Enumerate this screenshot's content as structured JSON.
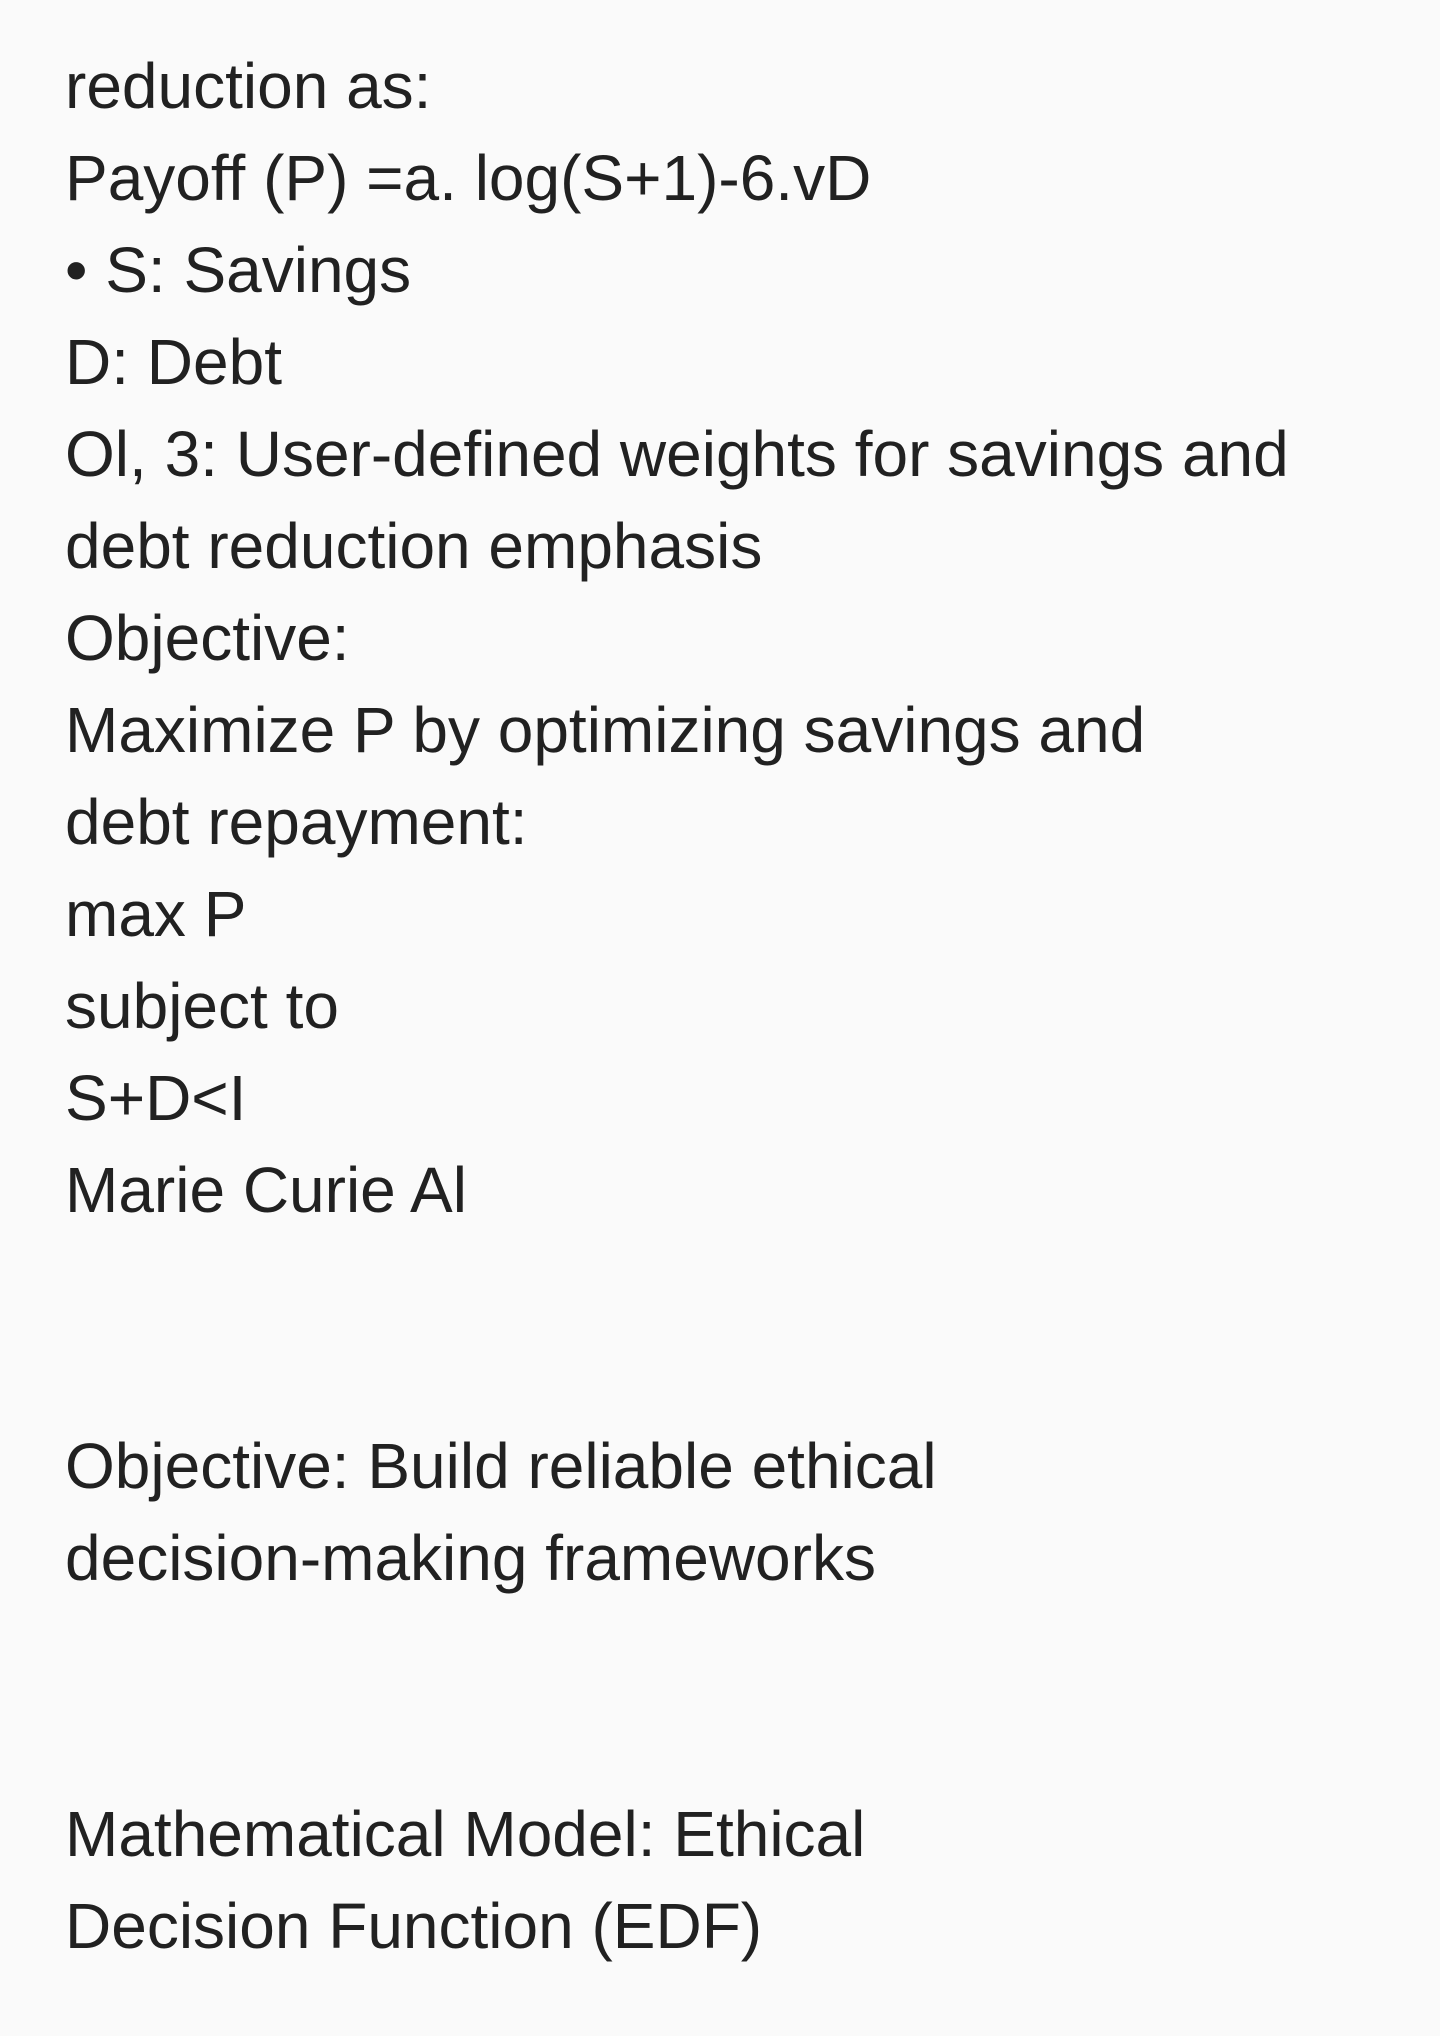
{
  "lines_block1": [
    "reduction as:",
    "Payoff (P) =a. log(S+1)-6.vD",
    "• S: Savings",
    "D: Debt",
    "Ol, 3: User-defined weights for savings and",
    "debt reduction emphasis",
    "Objective:",
    "Maximize P by optimizing savings and",
    "debt repayment:",
    "max P",
    "subject to",
    "S+D<I",
    "Marie Curie Al"
  ],
  "lines_block2": [
    "Objective: Build reliable ethical",
    "decision-making frameworks"
  ],
  "lines_block3": [
    "Mathematical Model: Ethical",
    "Decision Function (EDF)"
  ]
}
